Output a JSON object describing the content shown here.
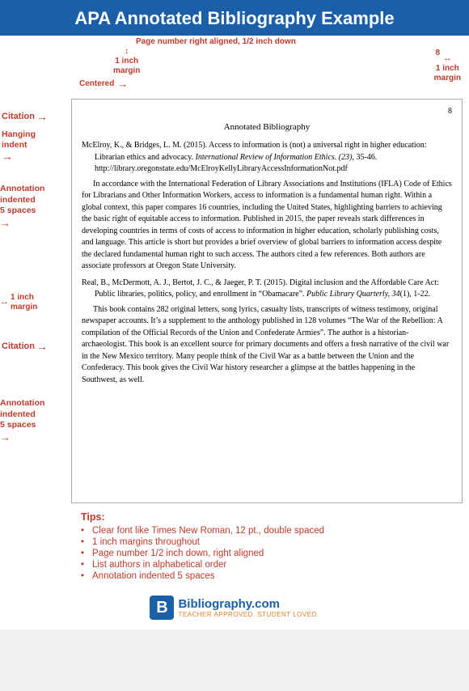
{
  "title": "APA Annotated Bibliography Example",
  "above_doc": {
    "page_num_label": "Page number right aligned, 1/2 inch down",
    "one_inch_margin": "1 inch\nmargin",
    "centered_label": "Centered",
    "right_margin_label": "1 inch\nmargin",
    "page_num_arrow": "8"
  },
  "document": {
    "heading": "Annotated Bibliography",
    "citation1": {
      "text": "McElroy, K., & Bridges, L. M. (2015). Access to information is (not) a universal right in higher education: Librarian ethics and advocacy. International Review of Information Ethics, (23), 35-46. http://library.oregonstate.edu/McElroyKellyLibraryAccessInformationNot.pdf"
    },
    "annotation1": "In accordance with the International Federation of Library Associations and Institutions (IFLA) Code of Ethics for Librarians and Other Information Workers, access to information is a fundamental human right. Within a global context, this paper compares 16 countries, including the United States, highlighting barriers to achieving the basic right of equitable access to information. Published in 2015, the paper reveals stark differences in developing countries in terms of costs of access to information in higher education, scholarly publishing costs, and language. This article is short but provides a brief overview of global barriers to information access despite the declared fundamental human right to such access. The authors cited a few references. Both authors are associate professors at Oregon State University.",
    "citation2": {
      "text": "Real, B., McDermott, A. J., Bertot, J. C., & Jaeger, P. T. (2015). Digital inclusion and the Affordable Care Act: Public libraries, politics, policy, and enrollment in \"Obamacare\". Public Library Quarterly, 34(1), 1-22."
    },
    "annotation2": "This book contains 282 original letters, song lyrics, casualty lists, transcripts of witness testimony, original newspaper accounts. It’s a supplement to the anthology published in 128 volumes “The War of the Rebellion: A compilation of the Official Records of the Union and Confederate Armies”. The author is a historian-archaeologist. This book is an excellent source for primary documents and offers a fresh narrative of the civil war in the New Mexico territory. Many people think of the Civil War as a battle between the Union and the Confederacy. This book gives the Civil War history researcher a glimpse at the battles happening in the Southwest, as well."
  },
  "left_annotations": {
    "citation_label": "Citation",
    "hanging_indent_label": "Hanging\nindent",
    "annotation_indented_label": "Annotation\nindented\n5 spaces",
    "one_inch_margin_label": "1 inch\nmargin",
    "citation2_label": "Citation",
    "annotation2_indented_label": "Annotation\nindented\n5 spaces"
  },
  "tips": {
    "title": "Tips:",
    "items": [
      "Clear font like Times New Roman, 12 pt., double spaced",
      "1 inch margins throughout",
      "Page number 1/2 inch down, right aligned",
      "List authors in alphabetical order",
      "Annotation indented 5 spaces"
    ]
  },
  "footer": {
    "logo_letter": "B",
    "site_name": "Bibliography.com",
    "tagline": "TEACHER APPROVED. STUDENT LOVED."
  }
}
